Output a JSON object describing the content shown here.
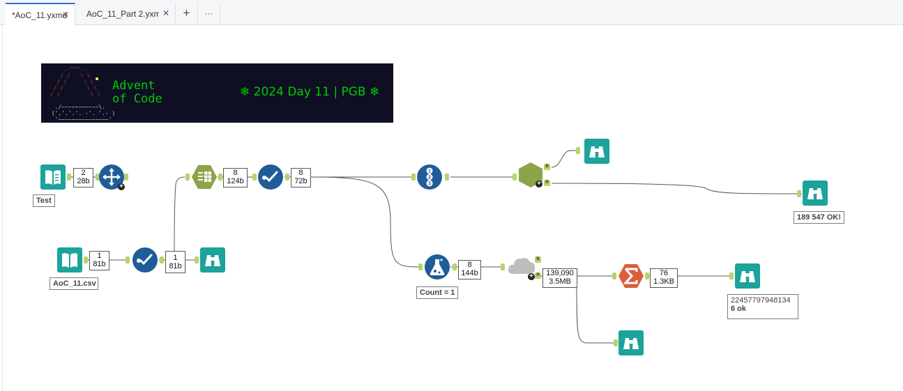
{
  "tabs": [
    {
      "label": "*AoC_11.yxmd",
      "close": "✕",
      "active": true
    },
    {
      "label": "AoC_11_Part 2.yxmc",
      "close": "✕",
      "active": false
    }
  ],
  "tab_actions": {
    "add": "+",
    "more": "···"
  },
  "banner": {
    "title": "Advent of Code",
    "subtitle": "❄   2024 Day 11 | PGB   ❄"
  },
  "record_counts": {
    "c1": {
      "records": "2",
      "size": "28b"
    },
    "c2": {
      "records": "8",
      "size": "124b"
    },
    "c3": {
      "records": "8",
      "size": "72b"
    },
    "c4": {
      "records": "1",
      "size": "81b"
    },
    "c5": {
      "records": "1",
      "size": "81b"
    },
    "c6": {
      "records": "8",
      "size": "144b"
    },
    "c7": {
      "records": "139,090",
      "size": "3.5MB"
    },
    "c8": {
      "records": "76",
      "size": "1.3KB"
    }
  },
  "annotations": {
    "input_test": "Test",
    "input_csv": "AoC_11.csv",
    "formula": "Count = 1",
    "browse_result1": "189 547 OK!",
    "browse_result2_line1": "22457797948134",
    "browse_result2_line2": "6 ok"
  },
  "colors": {
    "tab_accent": "#2f6fde",
    "io_teal": "#1ba39c",
    "prep_blue": "#1f5c99",
    "parse_green": "#8da34a",
    "summarize_orange": "#d9603b",
    "anchor_green": "#b5d46c",
    "banner_bg": "#0f0f23",
    "banner_text": "#00cc00"
  },
  "icons": [
    "book-input-icon",
    "select-icon",
    "text-to-columns-icon",
    "checkmark-filter-icon",
    "record-id-icon",
    "join-icon",
    "formula-flask-icon",
    "macro-cloud-icon",
    "summarize-sigma-icon",
    "binoculars-browse-icon"
  ]
}
